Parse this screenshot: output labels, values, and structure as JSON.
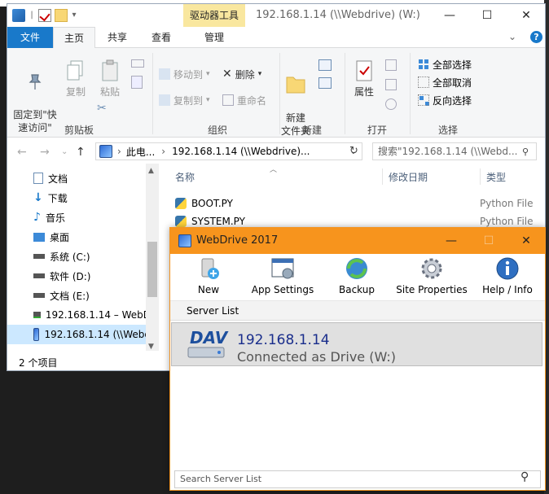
{
  "explorer": {
    "context_tab": "驱动器工具",
    "title": "192.168.1.14 (\\\\Webdrive) (W:)",
    "tabs": {
      "file": "文件",
      "home": "主页",
      "share": "共享",
      "view": "查看",
      "manage": "管理"
    },
    "ribbon": {
      "clipboard": {
        "pin": "固定到\"快\n速访问\"",
        "copy": "复制",
        "paste": "粘贴",
        "label": "剪贴板"
      },
      "organize": {
        "move_to": "移动到",
        "copy_to": "复制到",
        "delete": "删除",
        "rename": "重命名",
        "label": "组织"
      },
      "new": {
        "new_folder": "新建\n文件夹",
        "label": "新建"
      },
      "open": {
        "properties": "属性",
        "label": "打开"
      },
      "select": {
        "select_all": "全部选择",
        "select_none": "全部取消",
        "invert": "反向选择",
        "label": "选择"
      }
    },
    "address": {
      "seg1": "此电...",
      "seg2": "192.168.1.14 (\\\\Webdrive)..."
    },
    "search_placeholder": "搜索\"192.168.1.14 (\\\\Webd...",
    "nav": [
      {
        "label": "文档",
        "icon": "documents-icon"
      },
      {
        "label": "下载",
        "icon": "download-icon"
      },
      {
        "label": "音乐",
        "icon": "music-icon"
      },
      {
        "label": "桌面",
        "icon": "desktop-icon"
      },
      {
        "label": "系统 (C:)",
        "icon": "drive-icon"
      },
      {
        "label": "软件 (D:)",
        "icon": "drive-icon"
      },
      {
        "label": "文档 (E:)",
        "icon": "drive-icon"
      },
      {
        "label": "192.168.1.14 – WebD",
        "icon": "network-drive-icon"
      },
      {
        "label": "192.168.1.14 (\\\\Webd",
        "icon": "webdrive-icon"
      }
    ],
    "columns": {
      "name": "名称",
      "modified": "修改日期",
      "type": "类型"
    },
    "files": [
      {
        "name": "BOOT.PY",
        "type": "Python File"
      },
      {
        "name": "SYSTEM.PY",
        "type": "Python File"
      }
    ],
    "status": "2 个项目"
  },
  "webdrive": {
    "title": "WebDrive 2017",
    "toolbar": {
      "new": "New",
      "app_settings": "App Settings",
      "backup": "Backup",
      "site_properties": "Site Properties",
      "help": "Help / Info"
    },
    "list_header": "Server List",
    "server": {
      "host": "192.168.1.14",
      "status": "Connected as Drive (W:)",
      "badge": "DAV"
    },
    "search_placeholder": "Search Server List"
  }
}
